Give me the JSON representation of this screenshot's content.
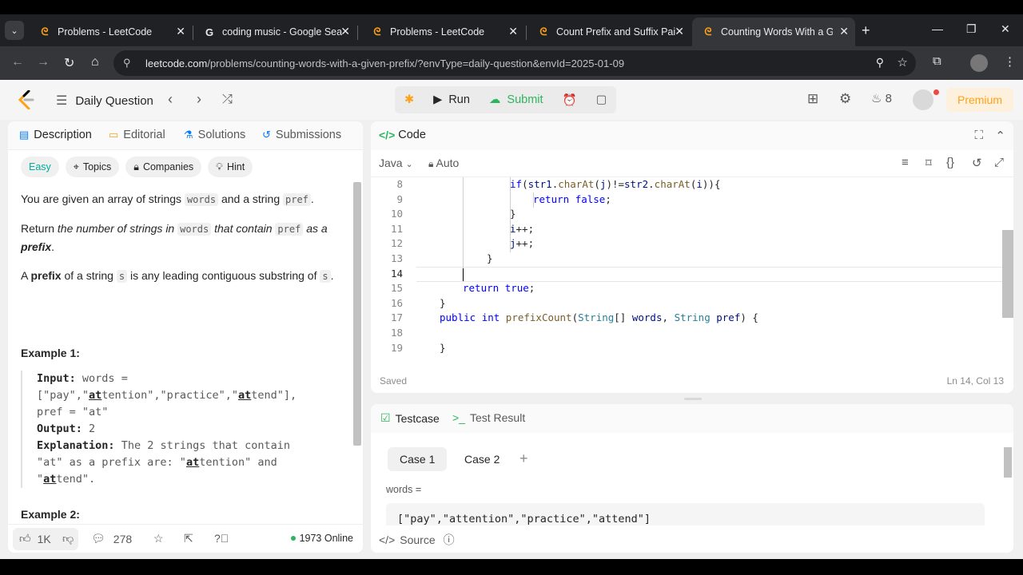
{
  "browser": {
    "tabs": [
      {
        "title": "Problems - LeetCode",
        "icon": "leetcode-icon"
      },
      {
        "title": "coding music - Google Searc",
        "icon": "google-icon"
      },
      {
        "title": "Problems - LeetCode",
        "icon": "leetcode-icon"
      },
      {
        "title": "Count Prefix and Suffix Pairs",
        "icon": "leetcode-icon"
      },
      {
        "title": "Counting Words With a Give",
        "icon": "leetcode-icon"
      }
    ],
    "active_tab": 4,
    "url_host": "leetcode.com",
    "url_path": "/problems/counting-words-with-a-given-prefix/?envType=daily-question&envId=2025-01-09"
  },
  "header": {
    "daily_label": "Daily Question",
    "run_label": "Run",
    "submit_label": "Submit",
    "streak": "8",
    "premium_label": "Premium"
  },
  "left": {
    "tabs": [
      "Description",
      "Editorial",
      "Solutions",
      "Submissions"
    ],
    "pills": {
      "difficulty": "Easy",
      "topics": "Topics",
      "companies": "Companies",
      "hint": "Hint"
    },
    "desc": {
      "p1a": "You are given an array of strings ",
      "p1code1": "words",
      "p1b": " and a string ",
      "p1code2": "pref",
      "p1c": ".",
      "p2a": "Return ",
      "p2i1": "the number of strings in ",
      "p2code": "words",
      "p2i2": " that contain ",
      "p2code2": "pref",
      "p2i3": " as a ",
      "p2b": "prefix",
      "p2c": ".",
      "p3a": "A ",
      "p3b": "prefix",
      "p3c": " of a string ",
      "p3code": "s",
      "p3d": " is any leading contiguous substring of ",
      "p3code2": "s",
      "p3e": "."
    },
    "example1": {
      "heading": "Example 1:",
      "input_label": "Input:",
      "input_l1": "words =",
      "input_l2a": "[\"pay\",\"",
      "input_l2u1": "at",
      "input_l2b": "tention\",\"practice\",\"",
      "input_l2u2": "at",
      "input_l2c": "tend\"],",
      "input_l3": "pref = \"at\"",
      "output_label": "Output:",
      "output_val": "2",
      "expl_label": "Explanation:",
      "expl_l1": "The 2 strings that contain",
      "expl_l2a": "\"at\" as a prefix are: \"",
      "expl_l2u": "at",
      "expl_l2b": "tention\" and",
      "expl_l3a": "\"",
      "expl_l3u": "at",
      "expl_l3b": "tend\"."
    },
    "example2_heading": "Example 2:",
    "likes": "1K",
    "comments": "278",
    "online": "1973 Online"
  },
  "code": {
    "title": "Code",
    "language": "Java",
    "mode": "Auto",
    "lines": [
      {
        "n": "8",
        "text": "if(str1.charAt(j)!=str2.charAt(i)){"
      },
      {
        "n": "9",
        "text": "return false;"
      },
      {
        "n": "10",
        "text": "}"
      },
      {
        "n": "11",
        "text": "i++;"
      },
      {
        "n": "12",
        "text": "j++;"
      },
      {
        "n": "13",
        "text": "}"
      },
      {
        "n": "14",
        "text": ""
      },
      {
        "n": "15",
        "text": "return true;"
      },
      {
        "n": "16",
        "text": "}"
      },
      {
        "n": "17",
        "text": "public int prefixCount(String[] words, String pref) {"
      },
      {
        "n": "18",
        "text": ""
      },
      {
        "n": "19",
        "text": "}"
      }
    ],
    "status": "Saved",
    "position": "Ln 14, Col 13"
  },
  "test": {
    "tab1": "Testcase",
    "tab2": "Test Result",
    "cases": [
      "Case 1",
      "Case 2"
    ],
    "words_label": "words =",
    "words_value": "[\"pay\",\"attention\",\"practice\",\"attend\"]",
    "source_label": "Source"
  },
  "colors": {
    "accent": "#ffa116",
    "submit": "#2db55d",
    "easy": "#00af9b"
  }
}
